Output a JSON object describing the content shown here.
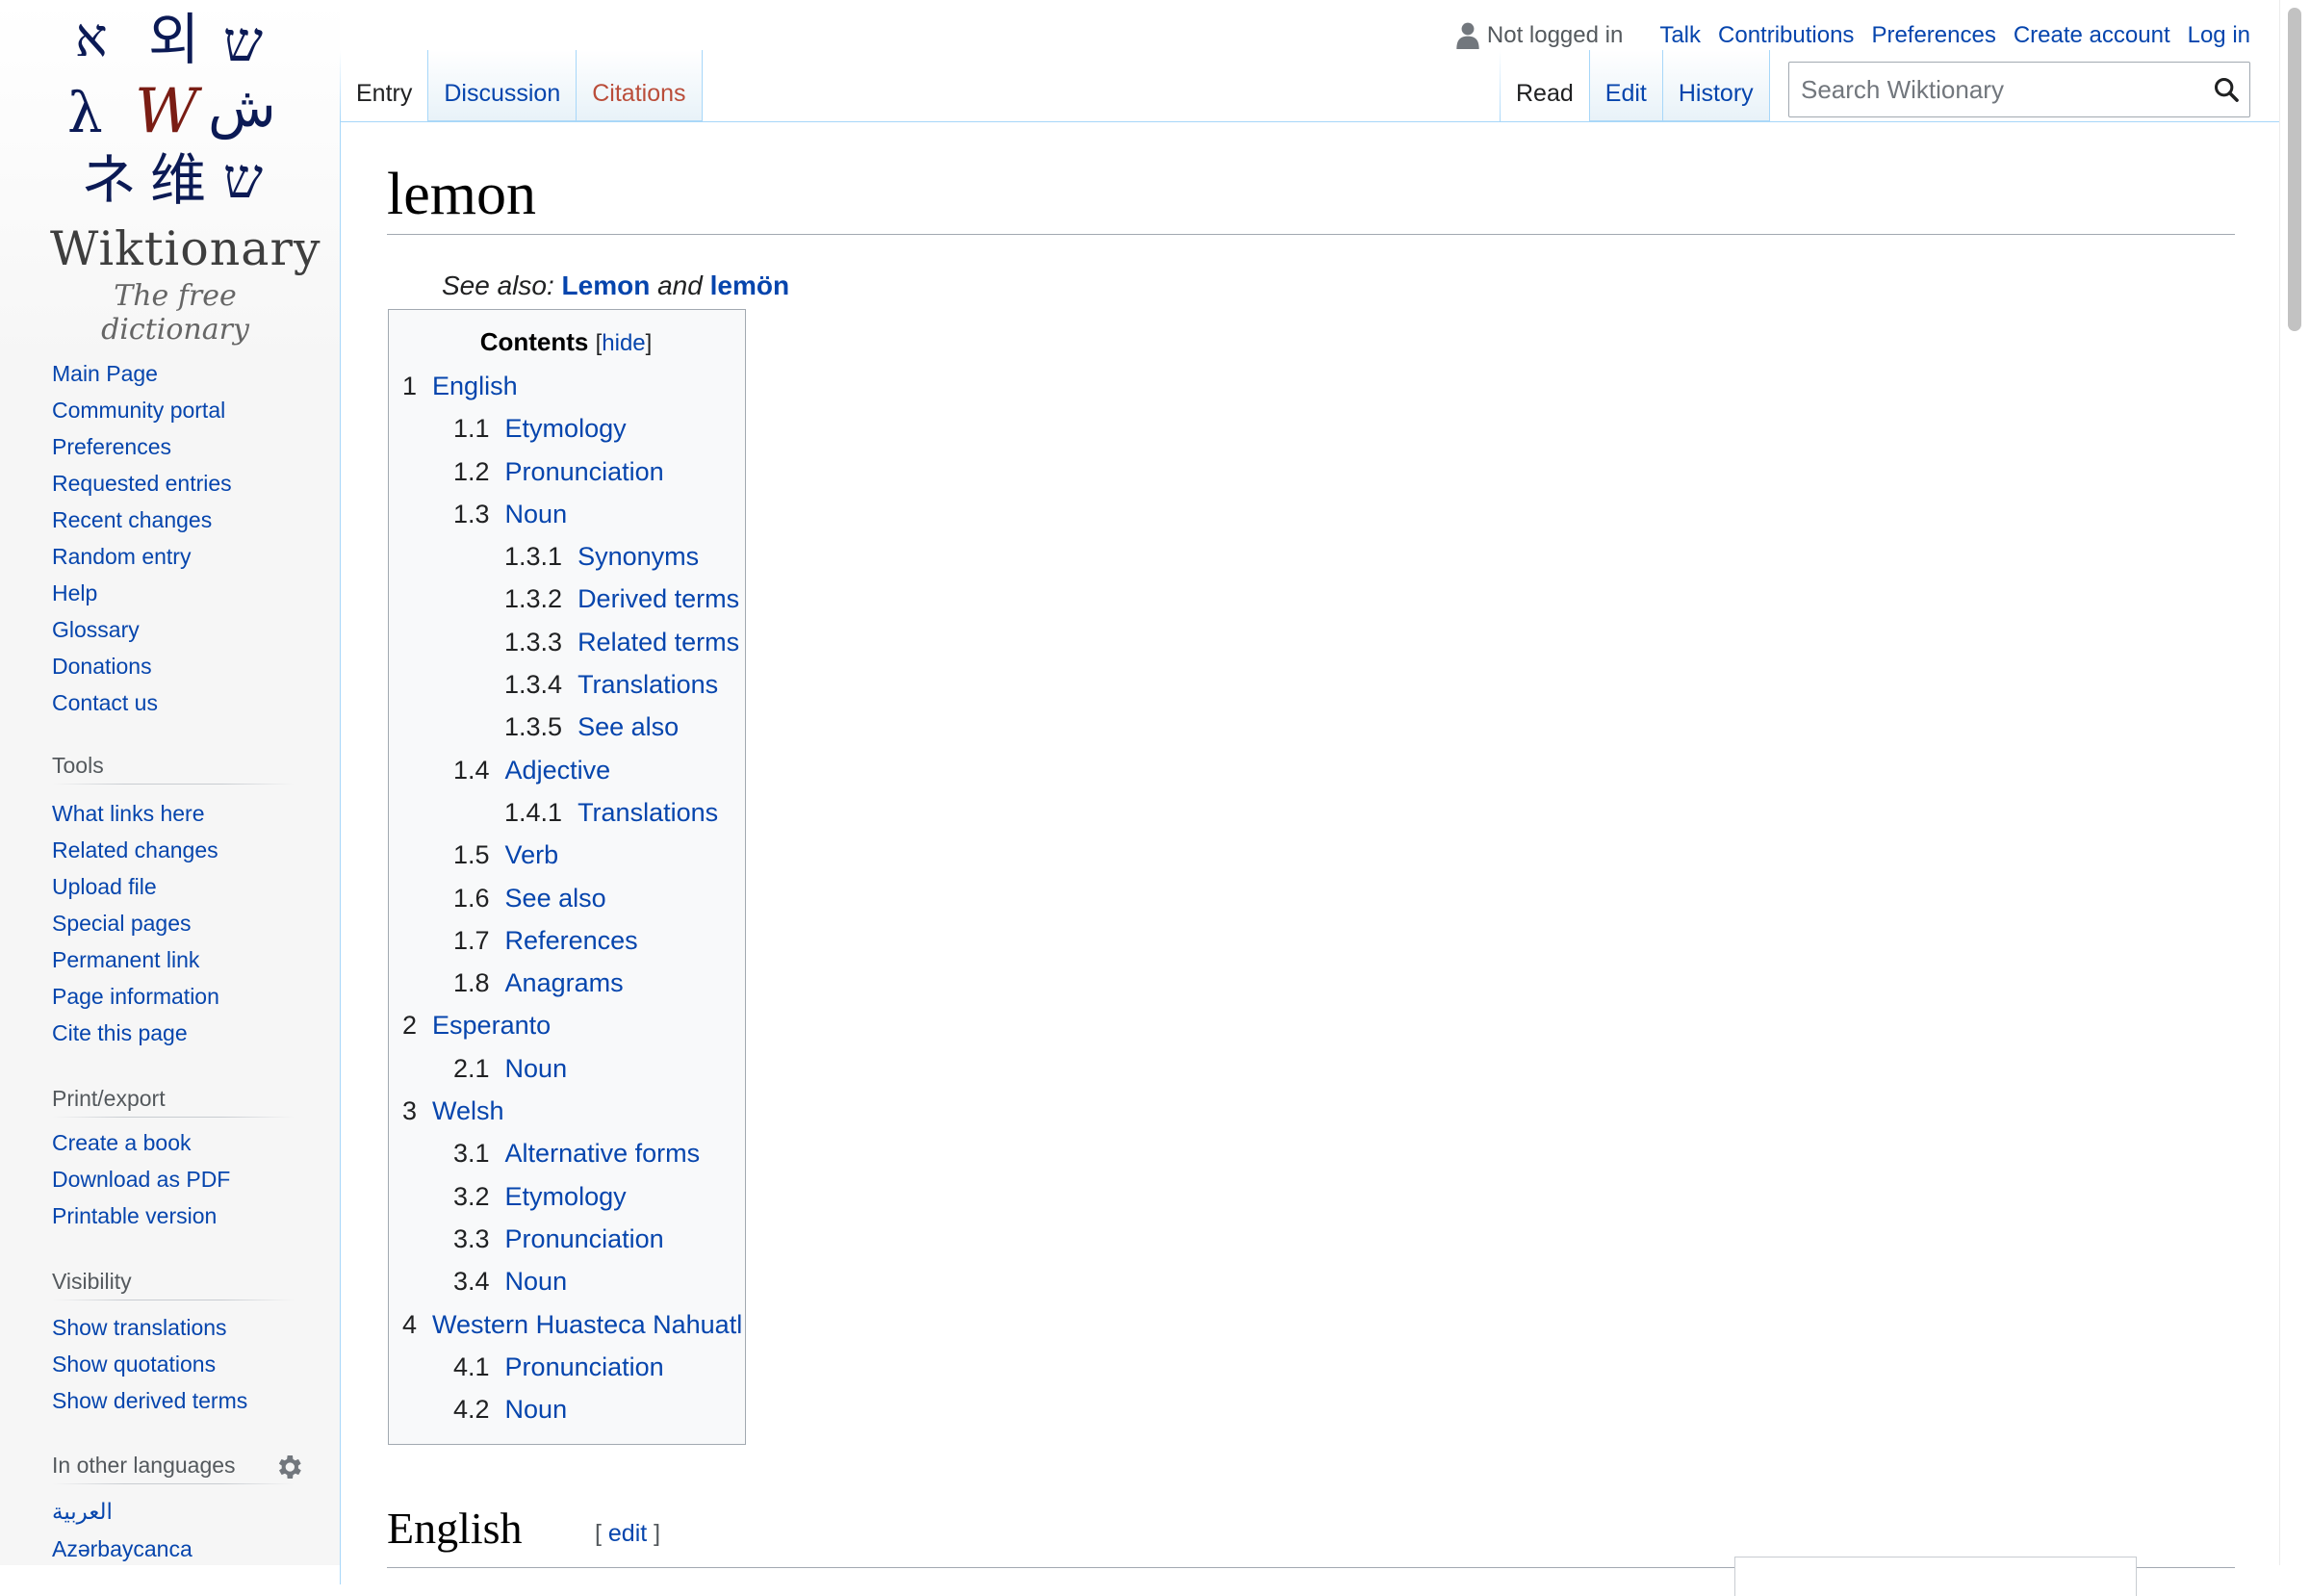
{
  "site": {
    "wordmark": "Wiktionary",
    "tagline": "The free dictionary",
    "logo_glyphs": [
      "ﬡ",
      "외",
      "ש",
      "λ",
      "W",
      "ش",
      "ネ",
      "维",
      "ש"
    ]
  },
  "personal": {
    "not_logged_in": "Not logged in",
    "links": [
      "Talk",
      "Contributions",
      "Preferences",
      "Create account",
      "Log in"
    ]
  },
  "tabs": {
    "left": [
      "Entry",
      "Discussion",
      "Citations"
    ],
    "right": [
      "Read",
      "Edit",
      "History"
    ]
  },
  "search": {
    "placeholder": "Search Wiktionary"
  },
  "navigation": [
    "Main Page",
    "Community portal",
    "Preferences",
    "Requested entries",
    "Recent changes",
    "Random entry",
    "Help",
    "Glossary",
    "Donations",
    "Contact us"
  ],
  "tools": {
    "heading": "Tools",
    "items": [
      "What links here",
      "Related changes",
      "Upload file",
      "Special pages",
      "Permanent link",
      "Page information",
      "Cite this page"
    ]
  },
  "print_export": {
    "heading": "Print/export",
    "items": [
      "Create a book",
      "Download as PDF",
      "Printable version"
    ]
  },
  "visibility": {
    "heading": "Visibility",
    "items": [
      "Show translations",
      "Show quotations",
      "Show derived terms"
    ]
  },
  "languages": {
    "heading": "In other languages",
    "items": [
      "العربية",
      "Azərbaycanca"
    ]
  },
  "article": {
    "title": "lemon",
    "see_also_label": "See also:",
    "see_also_1": "Lemon",
    "see_also_and": "and",
    "see_also_2": "lemön",
    "section_heading": "English",
    "edit_open": "[",
    "edit_label": "edit",
    "edit_close": "]"
  },
  "toc": {
    "title": "Contents",
    "hide_open": "[",
    "hide_label": "hide",
    "hide_close": "]",
    "items": [
      {
        "num": "1",
        "text": "English",
        "level": 1
      },
      {
        "num": "1.1",
        "text": "Etymology",
        "level": 2
      },
      {
        "num": "1.2",
        "text": "Pronunciation",
        "level": 2
      },
      {
        "num": "1.3",
        "text": "Noun",
        "level": 2
      },
      {
        "num": "1.3.1",
        "text": "Synonyms",
        "level": 3
      },
      {
        "num": "1.3.2",
        "text": "Derived terms",
        "level": 3
      },
      {
        "num": "1.3.3",
        "text": "Related terms",
        "level": 3
      },
      {
        "num": "1.3.4",
        "text": "Translations",
        "level": 3
      },
      {
        "num": "1.3.5",
        "text": "See also",
        "level": 3
      },
      {
        "num": "1.4",
        "text": "Adjective",
        "level": 2
      },
      {
        "num": "1.4.1",
        "text": "Translations",
        "level": 3
      },
      {
        "num": "1.5",
        "text": "Verb",
        "level": 2
      },
      {
        "num": "1.6",
        "text": "See also",
        "level": 2
      },
      {
        "num": "1.7",
        "text": "References",
        "level": 2
      },
      {
        "num": "1.8",
        "text": "Anagrams",
        "level": 2
      },
      {
        "num": "2",
        "text": "Esperanto",
        "level": 1
      },
      {
        "num": "2.1",
        "text": "Noun",
        "level": 2
      },
      {
        "num": "3",
        "text": "Welsh",
        "level": 1
      },
      {
        "num": "3.1",
        "text": "Alternative forms",
        "level": 2
      },
      {
        "num": "3.2",
        "text": "Etymology",
        "level": 2
      },
      {
        "num": "3.3",
        "text": "Pronunciation",
        "level": 2
      },
      {
        "num": "3.4",
        "text": "Noun",
        "level": 2
      },
      {
        "num": "4",
        "text": "Western Huasteca Nahuatl",
        "level": 1
      },
      {
        "num": "4.1",
        "text": "Pronunciation",
        "level": 2
      },
      {
        "num": "4.2",
        "text": "Noun",
        "level": 2
      }
    ]
  }
}
